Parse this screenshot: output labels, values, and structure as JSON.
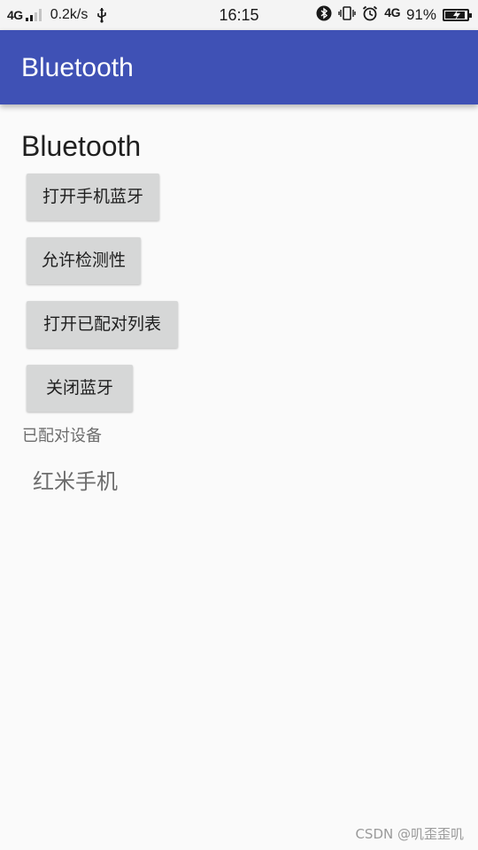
{
  "status_bar": {
    "network_left": "4G",
    "speed": "0.2k/s",
    "time": "16:15",
    "network_right": "4G",
    "battery": "91%",
    "battery_level": 0.91,
    "icons": [
      "signal-icon",
      "usb-icon",
      "bluetooth-icon",
      "vibrate-icon",
      "alarm-icon",
      "battery-charging-icon"
    ]
  },
  "app_bar": {
    "title": "Bluetooth",
    "color": "#3f51b5"
  },
  "content": {
    "title": "Bluetooth",
    "buttons": [
      {
        "label": "打开手机蓝牙"
      },
      {
        "label": "允许检测性"
      },
      {
        "label": "打开已配对列表"
      },
      {
        "label": "关闭蓝牙"
      }
    ],
    "paired_label": "已配对设备",
    "devices": [
      "红米手机"
    ]
  },
  "watermark": "CSDN @叽歪歪叽"
}
